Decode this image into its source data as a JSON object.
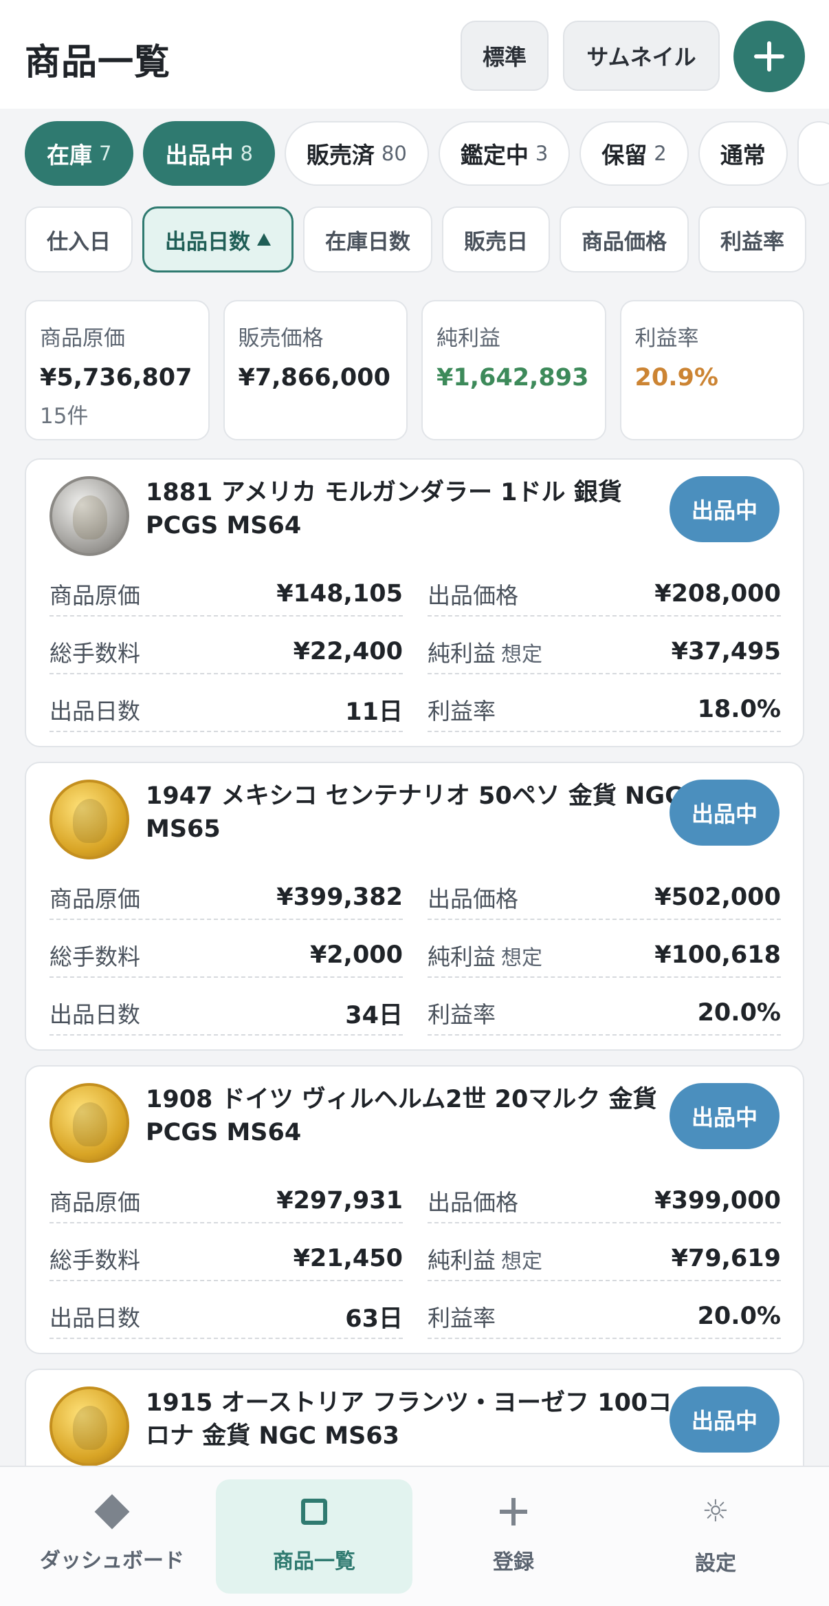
{
  "header": {
    "title": "商品一覧",
    "view_standard": "標準",
    "view_thumbnail": "サムネイル",
    "add_icon": "plus-icon"
  },
  "status_filters": [
    {
      "label": "在庫",
      "count": "7",
      "active": true
    },
    {
      "label": "出品中",
      "count": "8",
      "active": true
    },
    {
      "label": "販売済",
      "count": "80",
      "active": false
    },
    {
      "label": "鑑定中",
      "count": "3",
      "active": false
    },
    {
      "label": "保留",
      "count": "2",
      "active": false
    },
    {
      "label": "通常",
      "count": "",
      "active": false
    }
  ],
  "sort_options": [
    {
      "label": "仕入日",
      "active": false
    },
    {
      "label": "出品日数",
      "active": true,
      "direction": "up"
    },
    {
      "label": "在庫日数",
      "active": false
    },
    {
      "label": "販売日",
      "active": false
    },
    {
      "label": "商品価格",
      "active": false
    },
    {
      "label": "利益率",
      "active": false
    }
  ],
  "summary": {
    "cost": {
      "label": "商品原価",
      "value": "¥5,736,807",
      "sub": "15件"
    },
    "sale_price": {
      "label": "販売価格",
      "value": "¥7,866,000"
    },
    "net_profit": {
      "label": "純利益",
      "value": "¥1,642,893"
    },
    "margin": {
      "label": "利益率",
      "value": "20.9%"
    }
  },
  "labels": {
    "cost": "商品原価",
    "list_price": "出品価格",
    "fees": "総手数料",
    "net_profit": "純利益",
    "net_profit_hint": "想定",
    "listed_days": "出品日数",
    "margin": "利益率"
  },
  "products": [
    {
      "title": "1881 アメリカ モルガンダラー 1ドル 銀貨 PCGS MS64",
      "status": "出品中",
      "coin": "silver",
      "cost": "¥148,105",
      "list_price": "¥208,000",
      "fees": "¥22,400",
      "net_profit": "¥37,495",
      "listed_days": "11日",
      "margin": "18.0%"
    },
    {
      "title": "1947 メキシコ センテナリオ 50ペソ 金貨 NGC MS65",
      "status": "出品中",
      "coin": "gold",
      "cost": "¥399,382",
      "list_price": "¥502,000",
      "fees": "¥2,000",
      "net_profit": "¥100,618",
      "listed_days": "34日",
      "margin": "20.0%"
    },
    {
      "title": "1908 ドイツ ヴィルヘルム2世 20マルク 金貨 PCGS MS64",
      "status": "出品中",
      "coin": "gold",
      "cost": "¥297,931",
      "list_price": "¥399,000",
      "fees": "¥21,450",
      "net_profit": "¥79,619",
      "listed_days": "63日",
      "margin": "20.0%"
    },
    {
      "title": "1915 オーストリア フランツ・ヨーゼフ 100コロナ 金貨 NGC MS63",
      "status": "出品中",
      "coin": "gold"
    }
  ],
  "bottom_nav": [
    {
      "label": "ダッシュボード",
      "icon": "diamond-icon",
      "active": false
    },
    {
      "label": "商品一覧",
      "icon": "square-icon",
      "active": true
    },
    {
      "label": "登録",
      "icon": "plus-icon",
      "active": false
    },
    {
      "label": "設定",
      "icon": "gear-icon",
      "active": false
    }
  ],
  "colors": {
    "accent": "#2f7a70",
    "badge": "#4b8fbe",
    "profit": "#3d8a5a",
    "margin": "#cc8433"
  }
}
